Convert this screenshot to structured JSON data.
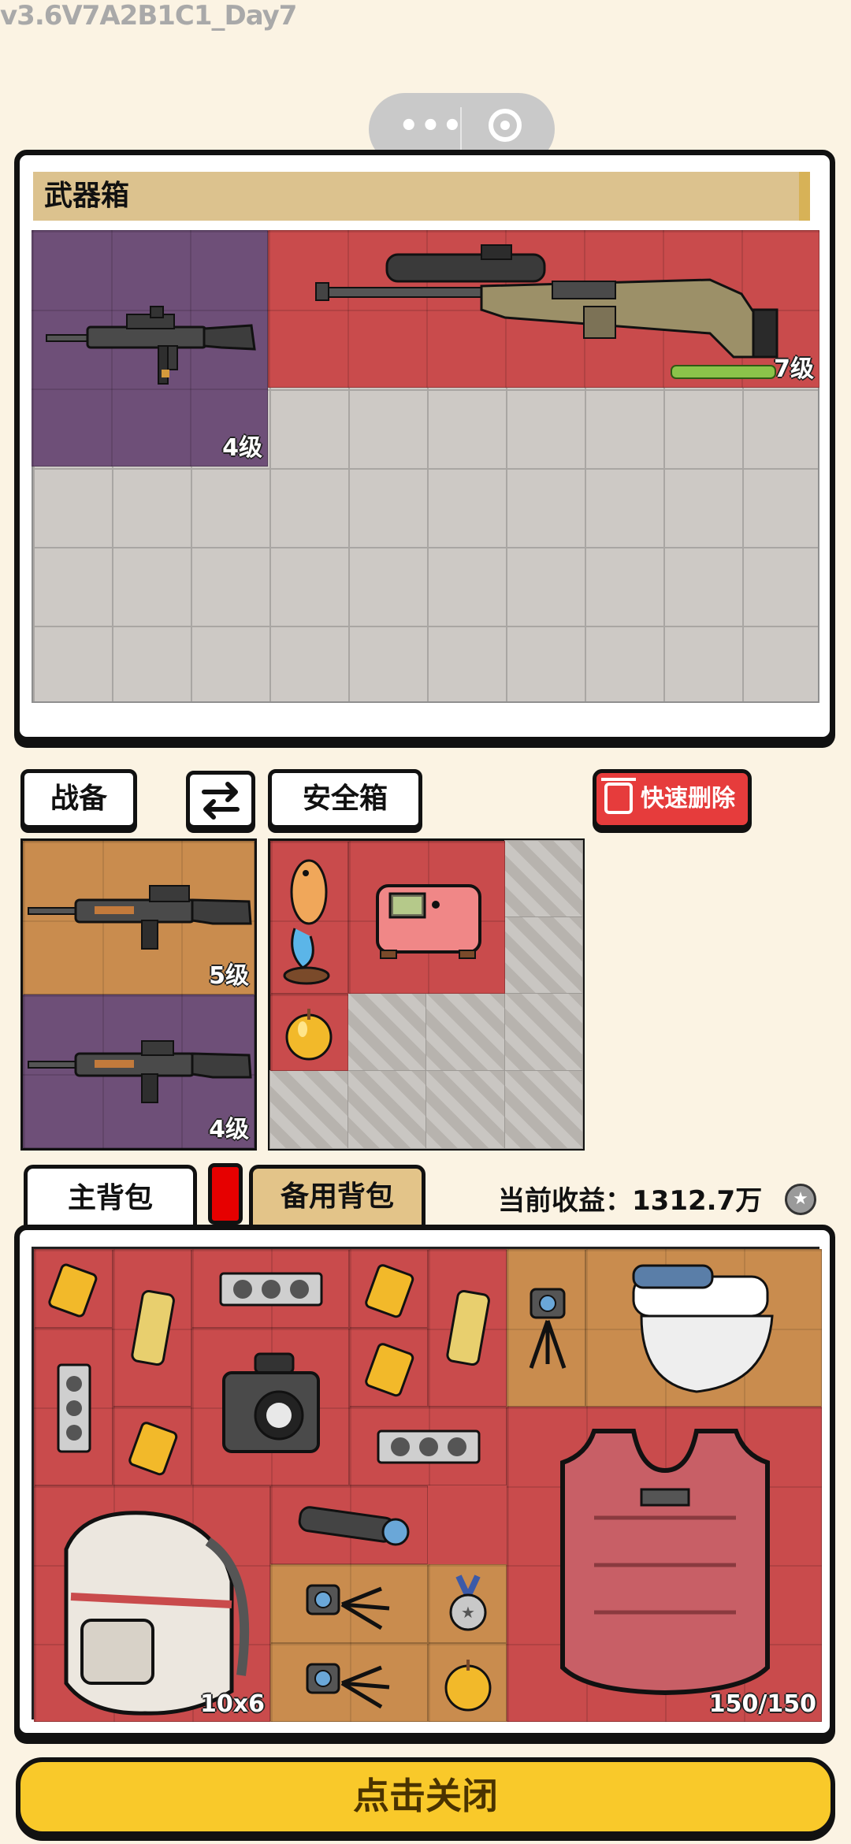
{
  "version_label": "v3.6V7A2B1C1_Day7",
  "weapon_box": {
    "title": "武器箱",
    "items": [
      {
        "name": "assault-rifle",
        "level": "4级",
        "color": "#6e4f78"
      },
      {
        "name": "sniper-rifle",
        "level": "7级",
        "color": "#c94b4c",
        "durability_fraction": 1.0
      }
    ]
  },
  "tabs": {
    "equipment_label": "战备",
    "safe_box_label": "安全箱",
    "swap_icon": "swap-arrows-icon",
    "quick_delete_label": "快速删除"
  },
  "equipment_slots": [
    {
      "name": "rifle",
      "level": "5级",
      "color": "#c98c4e"
    },
    {
      "name": "rifle",
      "level": "4级",
      "color": "#6e4f78"
    }
  ],
  "safe_box_items": [
    "goldfish-statue",
    "pink-machine",
    "golden-apple"
  ],
  "backpack": {
    "main_tab_label": "主背包",
    "backup_tab_label": "备用背包",
    "earnings_label": "当前收益：",
    "earnings_value": "1312.7万",
    "size_label": "10x6",
    "armor_durability": "150/150"
  },
  "close_button_label": "点击关闭"
}
